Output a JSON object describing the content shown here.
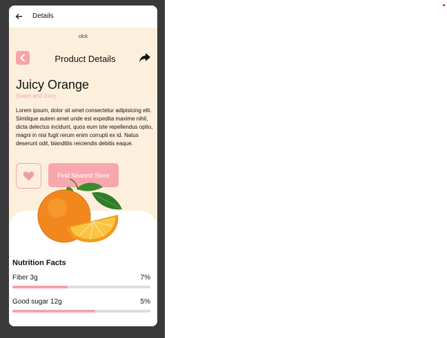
{
  "appbar": {
    "title": "Details"
  },
  "content": {
    "click_label": "click",
    "header_title": "Product Details",
    "product_name": "Juicy Orange",
    "product_subtitle": "Sweet and Juicy",
    "description": "Lorem ipsum, dolor sit amet consectetur adipisicing elit. Similique autem amet unde est expedita maxime nihil, dicta delectus incidunt, quos eum iste repellendus optio, magni in nisi fugit rerum enim corrupti ex id. Natus deserunt odit, blanditiis reiciendis debitis eaque.",
    "store_button": "Find Nearest Store"
  },
  "nutrition": {
    "title": "Nutrition Facts",
    "items": [
      {
        "label": "Fiber 3g",
        "percent": "7%",
        "fill": 0.4
      },
      {
        "label": "Good sugar 12g",
        "percent": "5%",
        "fill": 0.6
      }
    ]
  },
  "colors": {
    "accent": "#f7a3aa",
    "background": "#fcefdc",
    "subtitle": "#f4a3ab"
  },
  "icons": [
    "arrow-left-icon",
    "chevron-left-icon",
    "share-icon",
    "heart-icon"
  ]
}
